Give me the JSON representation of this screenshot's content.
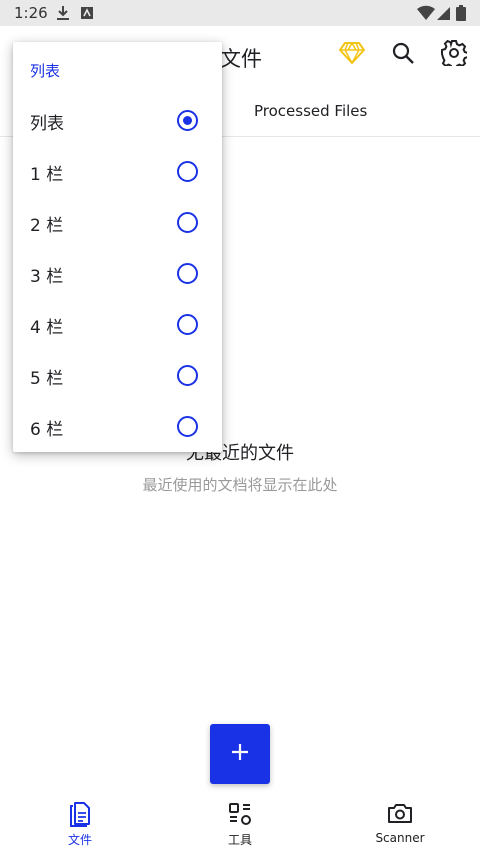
{
  "status_bar": {
    "time": "1:26"
  },
  "app_bar": {
    "title": "文件"
  },
  "tabs": {
    "processed": "Processed Files"
  },
  "empty_state": {
    "title": "无最近的文件",
    "subtitle": "最近使用的文档将显示在此处"
  },
  "view_menu": {
    "header": "列表",
    "options": [
      {
        "label": "列表",
        "selected": true
      },
      {
        "label": "1 栏",
        "selected": false
      },
      {
        "label": "2 栏",
        "selected": false
      },
      {
        "label": "3 栏",
        "selected": false
      },
      {
        "label": "4 栏",
        "selected": false
      },
      {
        "label": "5 栏",
        "selected": false
      },
      {
        "label": "6 栏",
        "selected": false
      }
    ]
  },
  "fab": {
    "label": "+"
  },
  "bottom_nav": {
    "items": [
      {
        "label": "文件",
        "icon": "document-icon",
        "active": true
      },
      {
        "label": "工具",
        "icon": "tools-icon",
        "active": false
      },
      {
        "label": "Scanner",
        "icon": "camera-icon",
        "active": false
      }
    ]
  },
  "colors": {
    "accent": "#1a32e6",
    "premium": "#f2c417",
    "status_bar": "#e9e9e9"
  }
}
